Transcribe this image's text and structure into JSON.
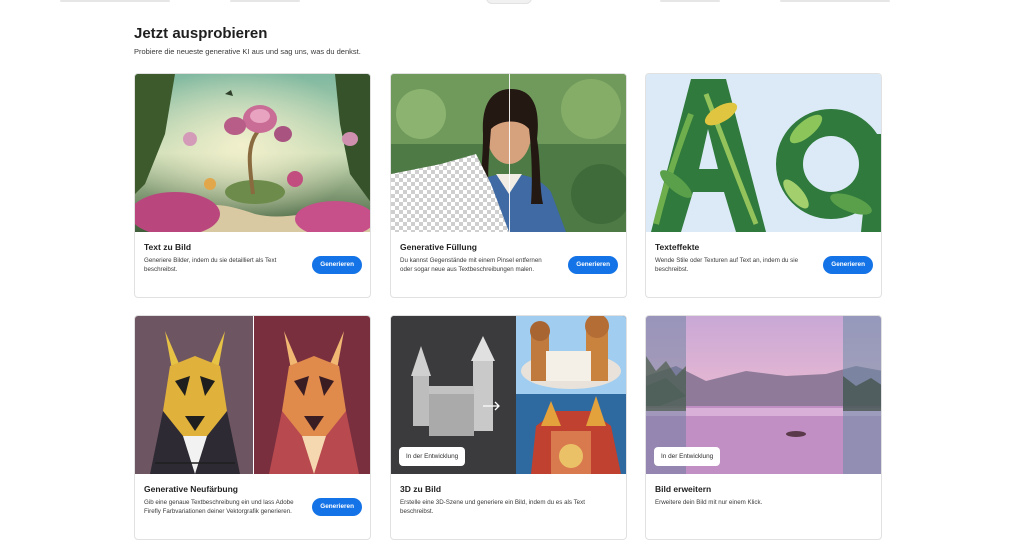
{
  "section": {
    "title": "Jetzt ausprobieren",
    "subtitle": "Probiere die neueste generative KI aus und sag uns, was du denkst."
  },
  "cards": [
    {
      "title": "Text zu Bild",
      "description": "Generiere Bilder, indem du sie detailliert als Text beschreibst.",
      "button": "Generieren"
    },
    {
      "title": "Generative Füllung",
      "description": "Du kannst Gegenstände mit einem Pinsel entfernen oder sogar neue aus Textbeschreibungen malen.",
      "button": "Generieren"
    },
    {
      "title": "Texteffekte",
      "description": "Wende Stile oder Texturen auf Text an, indem du sie beschreibst.",
      "button": "Generieren"
    },
    {
      "title": "Generative Neufärbung",
      "description": "Gib eine genaue Textbeschreibung ein und lass Adobe Firefly Farbvariationen deiner Vektorgrafik generieren.",
      "button": "Generieren"
    },
    {
      "title": "3D zu Bild",
      "description": "Erstelle eine 3D-Szene und generiere ein Bild, indem du es als Text beschreibst.",
      "badge": "In der Entwicklung"
    },
    {
      "title": "Bild erweitern",
      "description": "Erweitere dein Bild mit nur einem Klick.",
      "badge": "In der Entwicklung"
    }
  ],
  "colors": {
    "accent": "#1473e6"
  }
}
